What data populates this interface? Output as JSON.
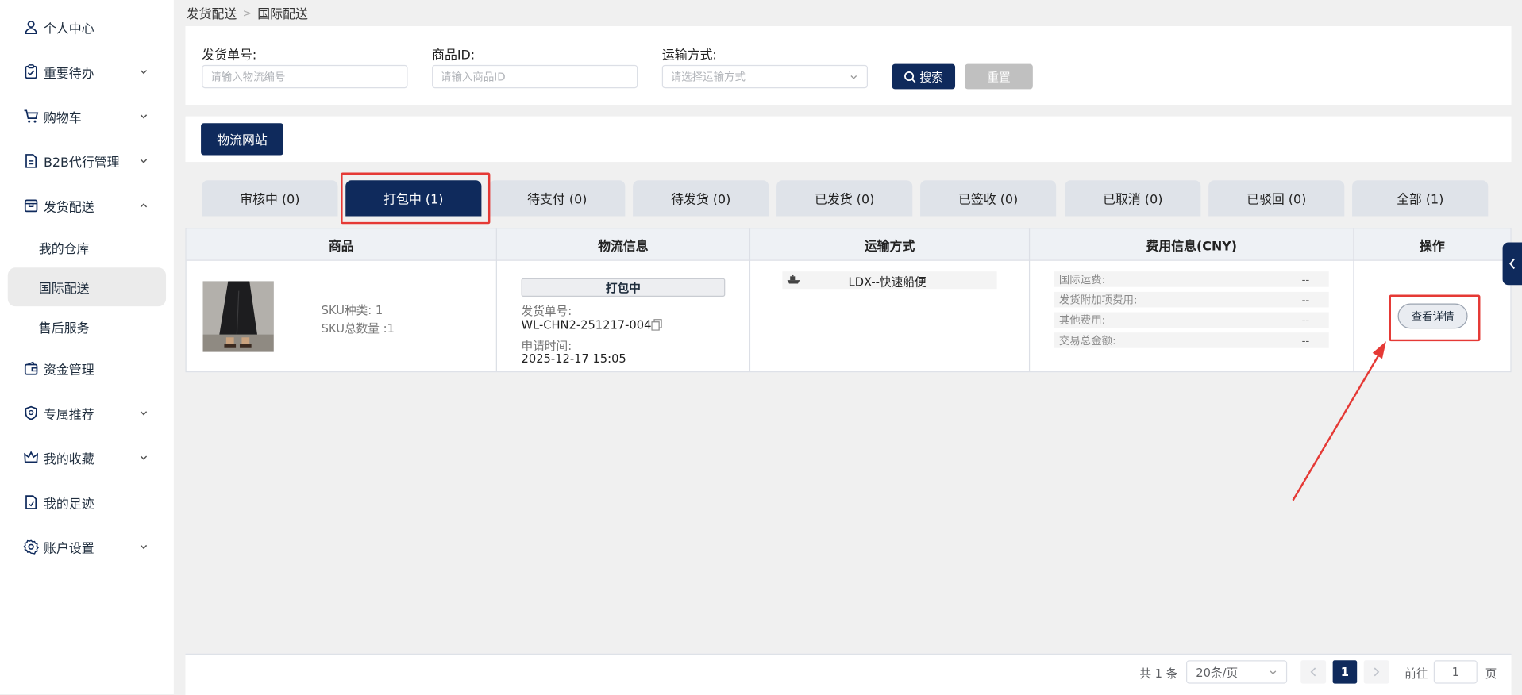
{
  "sidebar": {
    "items": [
      {
        "label": "个人中心",
        "icon": "user-icon"
      },
      {
        "label": "重要待办",
        "icon": "clipboard-check-icon"
      },
      {
        "label": "购物车",
        "icon": "cart-icon"
      },
      {
        "label": "B2B代行管理",
        "icon": "document-icon"
      },
      {
        "label": "发货配送",
        "icon": "box-icon"
      },
      {
        "label": "资金管理",
        "icon": "wallet-icon"
      },
      {
        "label": "专属推荐",
        "icon": "badge-icon"
      },
      {
        "label": "我的收藏",
        "icon": "crown-icon"
      },
      {
        "label": "我的足迹",
        "icon": "footprint-doc-icon"
      },
      {
        "label": "账户设置",
        "icon": "gear-icon"
      }
    ],
    "sub_items": [
      {
        "label": "我的仓库"
      },
      {
        "label": "国际配送"
      },
      {
        "label": "售后服务"
      }
    ]
  },
  "breadcrumb": {
    "parent": "发货配送",
    "separator": ">",
    "current": "国际配送"
  },
  "filters": {
    "shipment_no": {
      "label": "发货单号:",
      "placeholder": "请输入物流编号"
    },
    "product_id": {
      "label": "商品ID:",
      "placeholder": "请输入商品ID"
    },
    "transport": {
      "label": "运输方式:",
      "placeholder": "请选择运输方式"
    },
    "search_label": "搜索",
    "reset_label": "重置"
  },
  "logistics_site_label": "物流网站",
  "tabs": [
    {
      "label": "审核中 (0)"
    },
    {
      "label": "打包中 (1)"
    },
    {
      "label": "待支付 (0)"
    },
    {
      "label": "待发货 (0)"
    },
    {
      "label": "已发货 (0)"
    },
    {
      "label": "已签收 (0)"
    },
    {
      "label": "已取消 (0)"
    },
    {
      "label": "已驳回 (0)"
    },
    {
      "label": "全部 (1)"
    }
  ],
  "active_tab_index": 1,
  "table": {
    "headers": [
      "商品",
      "物流信息",
      "运输方式",
      "费用信息(CNY)",
      "操作"
    ],
    "row": {
      "sku_types": "SKU种类: 1",
      "sku_total": "SKU总数量 :1",
      "status": "打包中",
      "shipment_no_label": "发货单号:",
      "shipment_no": "WL-CHN2-251217-004",
      "apply_time_label": "申请时间:",
      "apply_time": "2025-12-17 15:05",
      "transport": "LDX--快速船便",
      "fees": [
        {
          "label": "国际运费:",
          "value": "--"
        },
        {
          "label": "发货附加项费用:",
          "value": "--"
        },
        {
          "label": "其他费用:",
          "value": "--"
        },
        {
          "label": "交易总金额:",
          "value": "--"
        }
      ],
      "action_label": "查看详情"
    }
  },
  "pagination": {
    "total": "共 1 条",
    "page_size": "20条/页",
    "current_page": "1",
    "goto_prefix": "前往",
    "goto_value": "1",
    "goto_suffix": "页"
  },
  "colors": {
    "primary": "#0f2a5c",
    "highlight": "#e53935",
    "tab_inactive": "#dfe3e9"
  }
}
